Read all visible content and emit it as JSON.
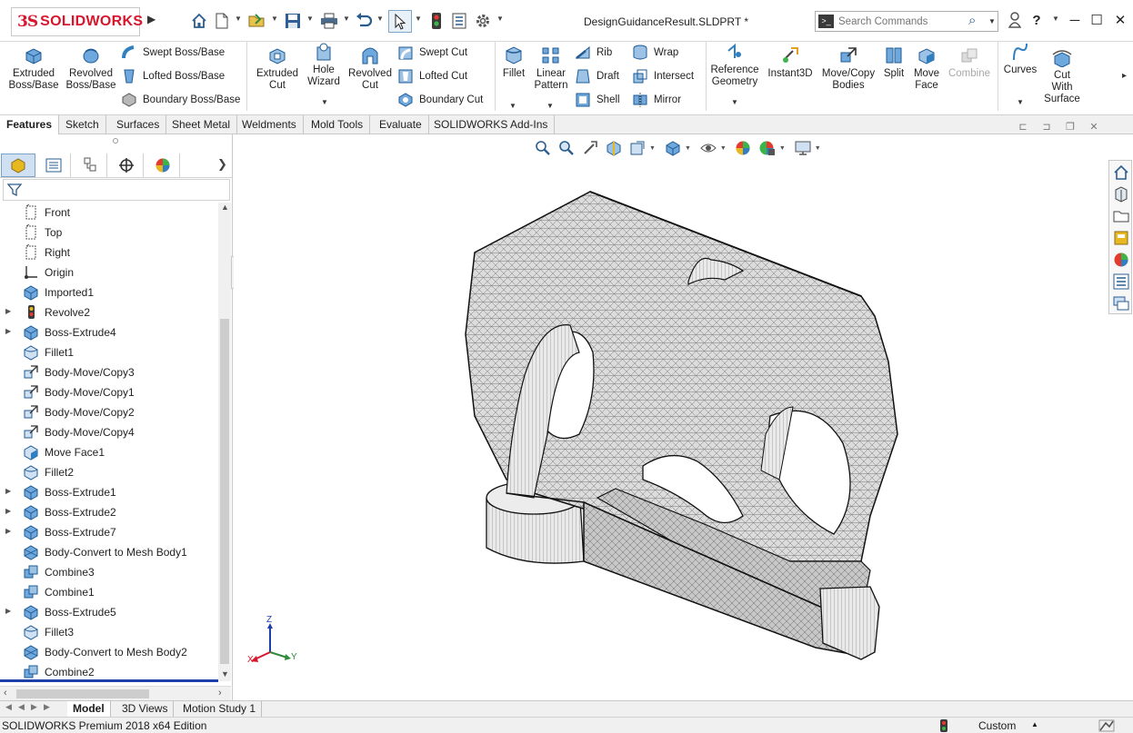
{
  "titlebar": {
    "brand": "SOLIDWORKS",
    "brand_mark": "3S",
    "document_title": "DesignGuidanceResult.SLDPRT *",
    "search_placeholder": "Search Commands",
    "quick_access_icons": [
      "home-icon",
      "new-document-icon",
      "open-icon",
      "save-icon",
      "print-icon",
      "undo-icon",
      "select-pointer-icon",
      "rebuild-icon",
      "file-properties-icon",
      "options-gear-icon"
    ],
    "window_buttons": [
      "user-icon",
      "help-icon",
      "minimize-icon",
      "maximize-icon",
      "close-icon"
    ]
  },
  "ribbon": {
    "extruded_boss": "Extruded Boss/Base",
    "revolved_boss": "Revolved Boss/Base",
    "swept_boss": "Swept Boss/Base",
    "lofted_boss": "Lofted Boss/Base",
    "boundary_boss": "Boundary Boss/Base",
    "extruded_cut": "Extruded Cut",
    "hole_wizard": "Hole Wizard",
    "revolved_cut": "Revolved Cut",
    "swept_cut": "Swept Cut",
    "lofted_cut": "Lofted Cut",
    "boundary_cut": "Boundary Cut",
    "fillet": "Fillet",
    "linear_pattern": "Linear Pattern",
    "rib": "Rib",
    "draft": "Draft",
    "shell": "Shell",
    "wrap": "Wrap",
    "intersect": "Intersect",
    "mirror": "Mirror",
    "reference_geometry": "Reference Geometry",
    "instant3d": "Instant3D",
    "move_copy_bodies": "Move/Copy Bodies",
    "split": "Split",
    "move_face": "Move Face",
    "combine": "Combine",
    "curves": "Curves",
    "cut_with_surface": "Cut With Surface"
  },
  "tabs": [
    "Features",
    "Sketch",
    "Surfaces",
    "Sheet Metal",
    "Weldments",
    "Mold Tools",
    "Evaluate",
    "SOLIDWORKS Add-Ins"
  ],
  "feature_tree": {
    "items": [
      {
        "label": "Front",
        "icon": "plane-icon",
        "expandable": false
      },
      {
        "label": "Top",
        "icon": "plane-icon",
        "expandable": false
      },
      {
        "label": "Right",
        "icon": "plane-icon",
        "expandable": false
      },
      {
        "label": "Origin",
        "icon": "origin-icon",
        "expandable": false
      },
      {
        "label": "Imported1",
        "icon": "imported-body-icon",
        "expandable": false
      },
      {
        "label": "Revolve2",
        "icon": "revolve-error-icon",
        "expandable": true
      },
      {
        "label": "Boss-Extrude4",
        "icon": "boss-extrude-icon",
        "expandable": true
      },
      {
        "label": "Fillet1",
        "icon": "fillet-icon",
        "expandable": false
      },
      {
        "label": "Body-Move/Copy3",
        "icon": "move-copy-icon",
        "expandable": false
      },
      {
        "label": "Body-Move/Copy1",
        "icon": "move-copy-icon",
        "expandable": false
      },
      {
        "label": "Body-Move/Copy2",
        "icon": "move-copy-icon",
        "expandable": false
      },
      {
        "label": "Body-Move/Copy4",
        "icon": "move-copy-icon",
        "expandable": false
      },
      {
        "label": "Move Face1",
        "icon": "move-face-icon",
        "expandable": false
      },
      {
        "label": "Fillet2",
        "icon": "fillet-icon",
        "expandable": false
      },
      {
        "label": "Boss-Extrude1",
        "icon": "boss-extrude-icon",
        "expandable": true
      },
      {
        "label": "Boss-Extrude2",
        "icon": "boss-extrude-icon",
        "expandable": true
      },
      {
        "label": "Boss-Extrude7",
        "icon": "boss-extrude-icon",
        "expandable": true
      },
      {
        "label": "Body-Convert to Mesh Body1",
        "icon": "convert-mesh-icon",
        "expandable": false
      },
      {
        "label": "Combine3",
        "icon": "combine-icon",
        "expandable": false
      },
      {
        "label": "Combine1",
        "icon": "combine-icon",
        "expandable": false
      },
      {
        "label": "Boss-Extrude5",
        "icon": "boss-extrude-icon",
        "expandable": true
      },
      {
        "label": "Fillet3",
        "icon": "fillet-icon",
        "expandable": false
      },
      {
        "label": "Body-Convert to Mesh Body2",
        "icon": "convert-mesh-icon",
        "expandable": false
      },
      {
        "label": "Combine2",
        "icon": "combine-icon",
        "expandable": false
      }
    ]
  },
  "bottom_tabs": [
    "Model",
    "3D Views",
    "Motion Study 1"
  ],
  "status": {
    "edition": "SOLIDWORKS Premium 2018 x64 Edition",
    "units": "Custom"
  },
  "triad": {
    "z": "Z",
    "x": "X",
    "y": "Y"
  },
  "colors": {
    "brand_red": "#d6162c",
    "icon_blue": "#2f7fc1",
    "mesh_gray": "#d9d9d9",
    "selection_blue": "#1f3fa8"
  }
}
